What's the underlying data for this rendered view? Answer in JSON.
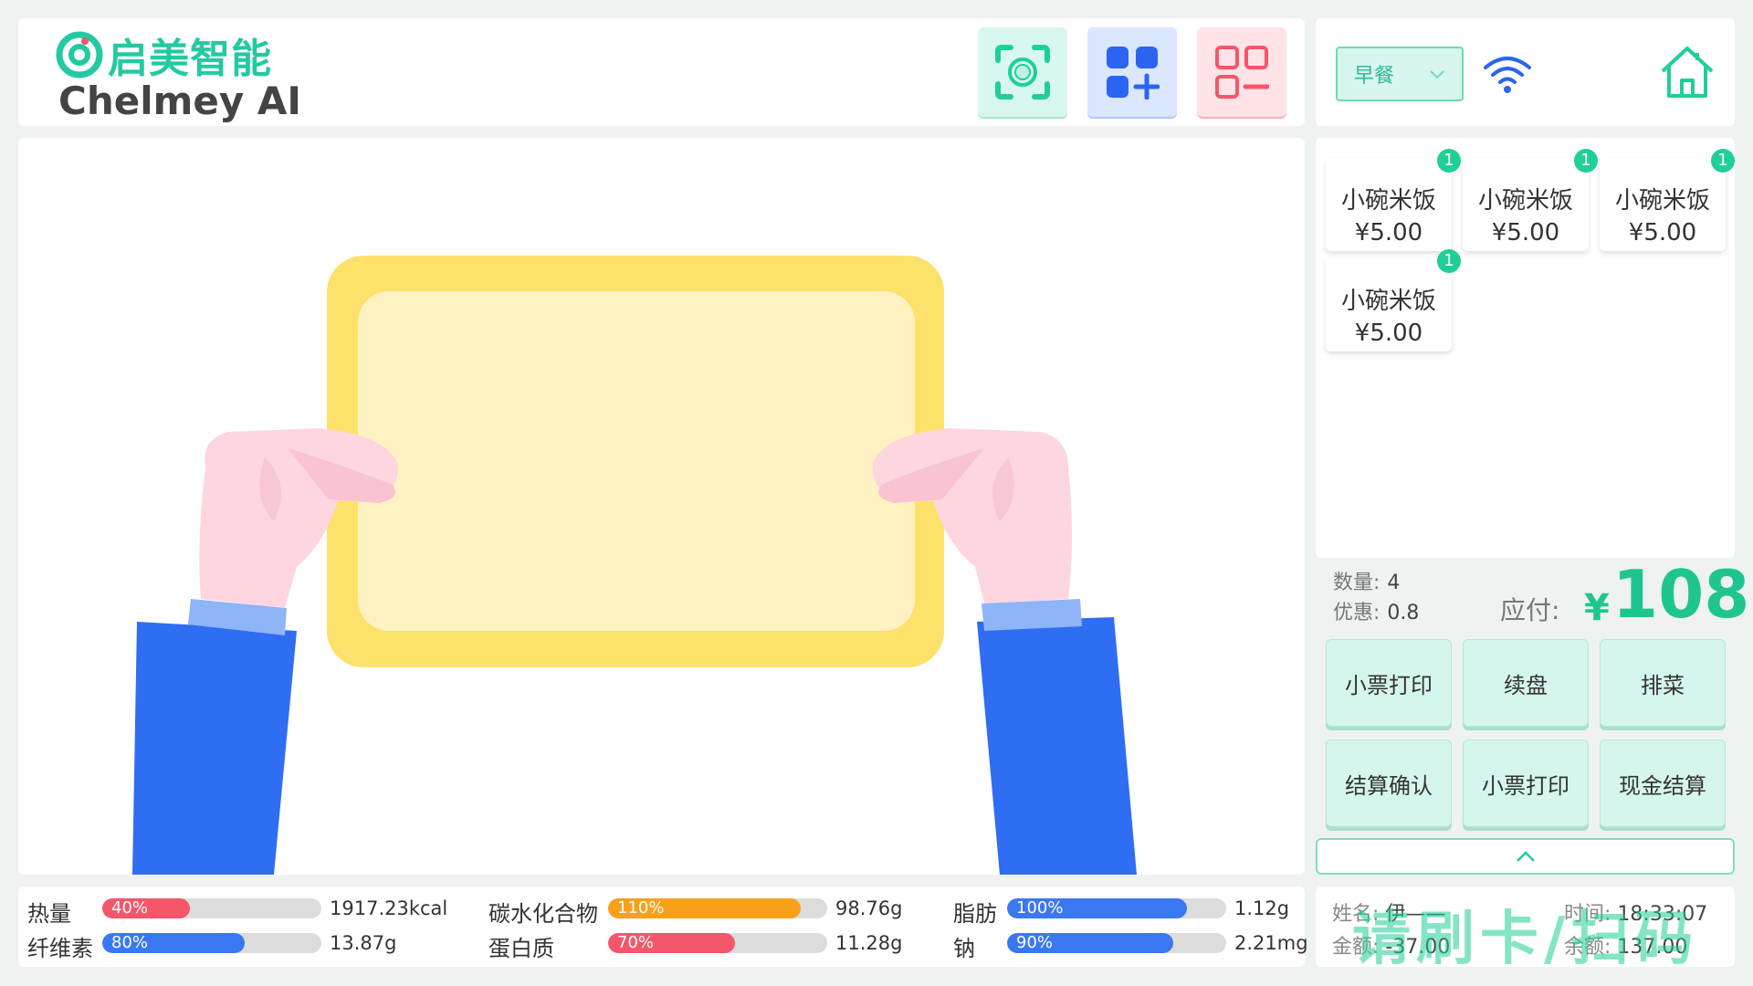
{
  "brand": {
    "name_cn": "启美智能",
    "name_en": "Chelmey AI",
    "accent": "#23c9a1"
  },
  "toolbar": {
    "scan_icon": "camera-scan-icon",
    "add_icon": "grid-add-icon",
    "remove_icon": "grid-remove-icon"
  },
  "meal": {
    "selected": "早餐"
  },
  "cart": {
    "items": [
      {
        "name": "小碗米饭",
        "price": "¥5.00",
        "count": "1"
      },
      {
        "name": "小碗米饭",
        "price": "¥5.00",
        "count": "1"
      },
      {
        "name": "小碗米饭",
        "price": "¥5.00",
        "count": "1"
      },
      {
        "name": "小碗米饭",
        "price": "¥5.00",
        "count": "1"
      }
    ]
  },
  "totals": {
    "qty_label": "数量:",
    "qty": "4",
    "discount_label": "优惠:",
    "discount": "0.8",
    "pay_label": "应付:",
    "currency": "¥",
    "amount": "108"
  },
  "actions": [
    "小票打印",
    "续盘",
    "排菜",
    "结算确认",
    "小票打印",
    "现金结算"
  ],
  "nutrition": [
    {
      "label": "热量",
      "pct": "40%",
      "value": "1917.23kcal",
      "color": "#f4566a"
    },
    {
      "label": "纤维素",
      "pct": "80%",
      "value": "13.87g",
      "color": "#3a78f2"
    },
    {
      "label": "碳水化合物",
      "pct": "110%",
      "value": "98.76g",
      "color": "#f9a01b"
    },
    {
      "label": "蛋白质",
      "pct": "70%",
      "value": "11.28g",
      "color": "#f4566a"
    },
    {
      "label": "脂肪",
      "pct": "100%",
      "value": "1.12g",
      "color": "#3a78f2"
    },
    {
      "label": "钠",
      "pct": "90%",
      "value": "2.21mg",
      "color": "#3a78f2"
    }
  ],
  "info": {
    "name_label": "姓名:",
    "name": "伊——",
    "time_label": "时间:",
    "time": "18:33:07",
    "amount_label": "金额:",
    "amount": "-37.00",
    "balance_label": "余额:",
    "balance": "137.00",
    "prompt": "请刷卡/扫码"
  }
}
